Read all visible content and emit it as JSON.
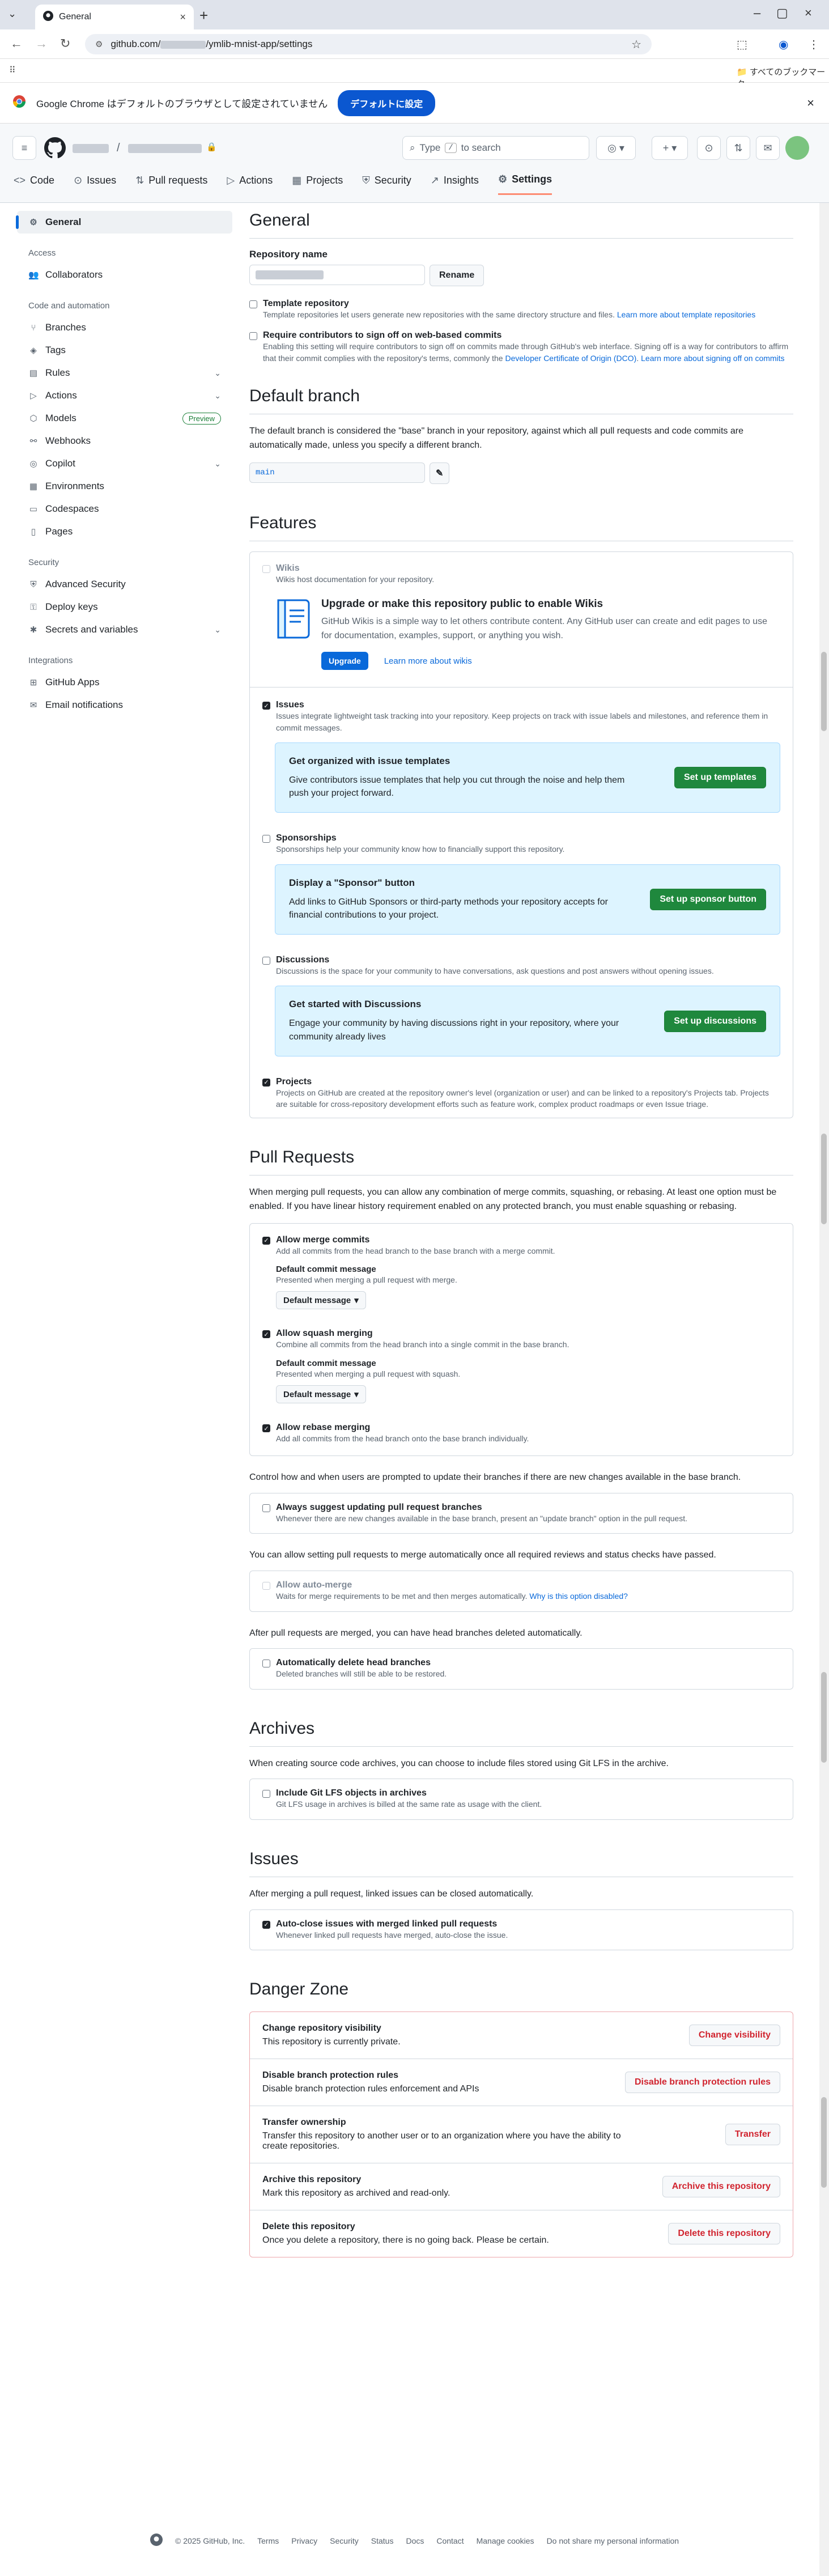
{
  "browser": {
    "tab_title": "General",
    "url_prefix": "github.com/",
    "url_suffix": "/ymlib-mnist-app/settings",
    "bookmarks_label": "すべてのブックマーク",
    "infobar_text": "Google Chrome はデフォルトのブラウザとして設定されていません",
    "infobar_button": "デフォルトに設定"
  },
  "header": {
    "search_prefix": "Type",
    "search_key": "/",
    "search_suffix": "to search"
  },
  "repo_tabs": [
    {
      "label": "Code",
      "icon": "code-icon"
    },
    {
      "label": "Issues",
      "icon": "issue-icon"
    },
    {
      "label": "Pull requests",
      "icon": "pull-request-icon"
    },
    {
      "label": "Actions",
      "icon": "play-icon"
    },
    {
      "label": "Projects",
      "icon": "table-icon"
    },
    {
      "label": "Security",
      "icon": "shield-icon"
    },
    {
      "label": "Insights",
      "icon": "graph-icon"
    },
    {
      "label": "Settings",
      "icon": "gear-icon"
    }
  ],
  "sidebar": {
    "general": "General",
    "access_heading": "Access",
    "collaborators": "Collaborators",
    "code_heading": "Code and automation",
    "code_items": [
      "Branches",
      "Tags",
      "Rules",
      "Actions",
      "Models",
      "Webhooks",
      "Copilot",
      "Environments",
      "Codespaces",
      "Pages"
    ],
    "preview_badge": "Preview",
    "security_heading": "Security",
    "security_items": [
      "Advanced Security",
      "Deploy keys",
      "Secrets and variables"
    ],
    "integrations_heading": "Integrations",
    "integration_items": [
      "GitHub Apps",
      "Email notifications"
    ]
  },
  "general": {
    "title": "General",
    "repo_name_label": "Repository name",
    "rename_button": "Rename",
    "template_label": "Template repository",
    "template_desc": "Template repositories let users generate new repositories with the same directory structure and files.",
    "template_link": "Learn more about template repositories",
    "signoff_label": "Require contributors to sign off on web-based commits",
    "signoff_desc": "Enabling this setting will require contributors to sign off on commits made through GitHub's web interface. Signing off is a way for contributors to affirm that their commit complies with the repository's terms, commonly the",
    "signoff_link1": "Developer Certificate of Origin (DCO)",
    "signoff_link2": "Learn more about signing off on commits"
  },
  "default_branch": {
    "title": "Default branch",
    "desc": "The default branch is considered the \"base\" branch in your repository, against which all pull requests and code commits are automatically made, unless you specify a different branch.",
    "branch": "main"
  },
  "features": {
    "title": "Features",
    "wikis_label": "Wikis",
    "wikis_desc": "Wikis host documentation for your repository.",
    "wiki_upgrade_title": "Upgrade or make this repository public to enable Wikis",
    "wiki_upgrade_desc": "GitHub Wikis is a simple way to let others contribute content. Any GitHub user can create and edit pages to use for documentation, examples, support, or anything you wish.",
    "upgrade_button": "Upgrade",
    "learn_wikis": "Learn more about wikis",
    "issues_label": "Issues",
    "issues_desc": "Issues integrate lightweight task tracking into your repository. Keep projects on track with issue labels and milestones, and reference them in commit messages.",
    "issues_promo_title": "Get organized with issue templates",
    "issues_promo_desc": "Give contributors issue templates that help you cut through the noise and help them push your project forward.",
    "issues_promo_button": "Set up templates",
    "sponsorships_label": "Sponsorships",
    "sponsorships_desc": "Sponsorships help your community know how to financially support this repository.",
    "sponsor_promo_title": "Display a \"Sponsor\" button",
    "sponsor_promo_desc": "Add links to GitHub Sponsors or third-party methods your repository accepts for financial contributions to your project.",
    "sponsor_promo_button": "Set up sponsor button",
    "discussions_label": "Discussions",
    "discussions_desc": "Discussions is the space for your community to have conversations, ask questions and post answers without opening issues.",
    "discussions_promo_title": "Get started with Discussions",
    "discussions_promo_desc": "Engage your community by having discussions right in your repository, where your community already lives",
    "discussions_promo_button": "Set up discussions",
    "projects_label": "Projects",
    "projects_desc": "Projects on GitHub are created at the repository owner's level (organization or user) and can be linked to a repository's Projects tab. Projects are suitable for cross-repository development efforts such as feature work, complex product roadmaps or even Issue triage."
  },
  "pull_requests": {
    "title": "Pull Requests",
    "intro": "When merging pull requests, you can allow any combination of merge commits, squashing, or rebasing. At least one option must be enabled. If you have linear history requirement enabled on any protected branch, you must enable squashing or rebasing.",
    "merge_label": "Allow merge commits",
    "merge_desc": "Add all commits from the head branch to the base branch with a merge commit.",
    "default_commit_label": "Default commit message",
    "merge_msg_desc": "Presented when merging a pull request with merge.",
    "default_message": "Default message",
    "squash_label": "Allow squash merging",
    "squash_desc": "Combine all commits from the head branch into a single commit in the base branch.",
    "squash_msg_desc": "Presented when merging a pull request with squash.",
    "rebase_label": "Allow rebase merging",
    "rebase_desc": "Add all commits from the head branch onto the base branch individually.",
    "update_intro": "Control how and when users are prompted to update their branches if there are new changes available in the base branch.",
    "suggest_label": "Always suggest updating pull request branches",
    "suggest_desc": "Whenever there are new changes available in the base branch, present an \"update branch\" option in the pull request.",
    "automerge_intro": "You can allow setting pull requests to merge automatically once all required reviews and status checks have passed.",
    "automerge_label": "Allow auto-merge",
    "automerge_desc": "Waits for merge requirements to be met and then merges automatically.",
    "automerge_link": "Why is this option disabled?",
    "delete_intro": "After pull requests are merged, you can have head branches deleted automatically.",
    "delete_label": "Automatically delete head branches",
    "delete_desc": "Deleted branches will still be able to be restored."
  },
  "archives": {
    "title": "Archives",
    "intro": "When creating source code archives, you can choose to include files stored using Git LFS in the archive.",
    "lfs_label": "Include Git LFS objects in archives",
    "lfs_desc": "Git LFS usage in archives is billed at the same rate as usage with the client."
  },
  "issues": {
    "title": "Issues",
    "intro": "After merging a pull request, linked issues can be closed automatically.",
    "autoclose_label": "Auto-close issues with merged linked pull requests",
    "autoclose_desc": "Whenever linked pull requests have merged, auto-close the issue."
  },
  "danger": {
    "title": "Danger Zone",
    "rows": [
      {
        "title": "Change repository visibility",
        "desc": "This repository is currently private.",
        "button": "Change visibility"
      },
      {
        "title": "Disable branch protection rules",
        "desc": "Disable branch protection rules enforcement and APIs",
        "button": "Disable branch protection rules"
      },
      {
        "title": "Transfer ownership",
        "desc": "Transfer this repository to another user or to an organization where you have the ability to create repositories.",
        "button": "Transfer"
      },
      {
        "title": "Archive this repository",
        "desc": "Mark this repository as archived and read-only.",
        "button": "Archive this repository"
      },
      {
        "title": "Delete this repository",
        "desc": "Once you delete a repository, there is no going back. Please be certain.",
        "button": "Delete this repository"
      }
    ]
  },
  "footer": {
    "copyright": "© 2025 GitHub, Inc.",
    "links": [
      "Terms",
      "Privacy",
      "Security",
      "Status",
      "Docs",
      "Contact",
      "Manage cookies",
      "Do not share my personal information"
    ]
  },
  "colors": {
    "accent": "#0969da",
    "green_button": "#1f883d",
    "danger": "#d1242f",
    "settings_tab_underline": "#fd8c73"
  }
}
